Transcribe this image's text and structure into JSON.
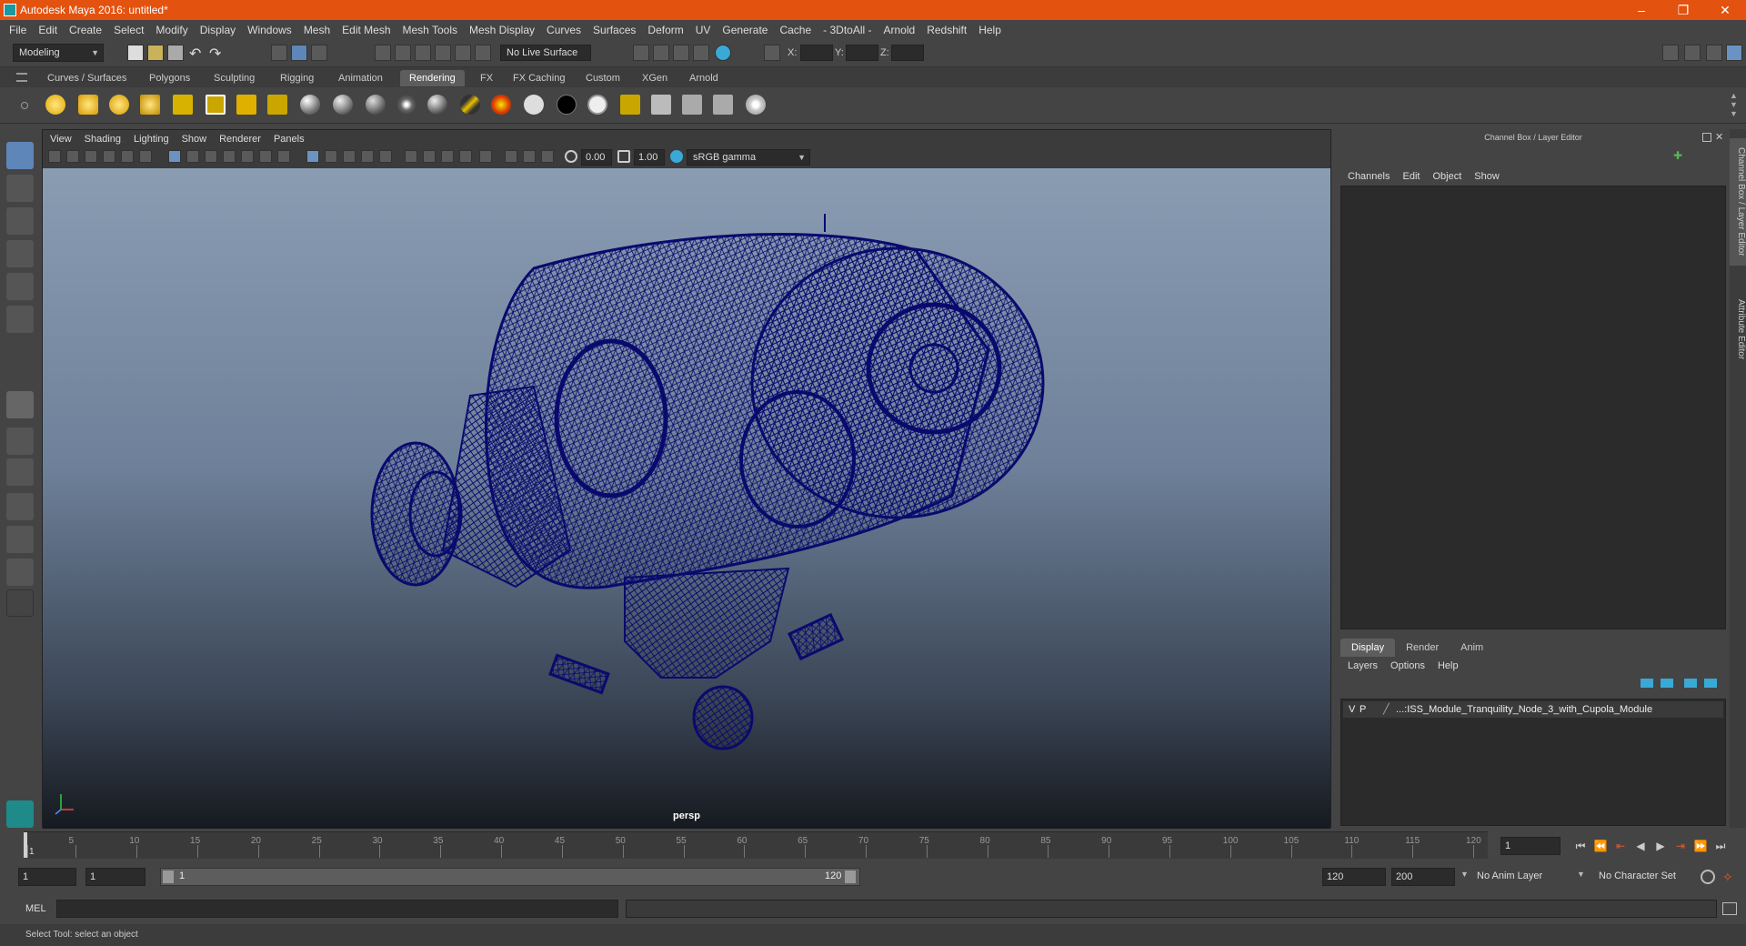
{
  "window": {
    "title": "Autodesk Maya 2016: untitled*"
  },
  "menubar": [
    "File",
    "Edit",
    "Create",
    "Select",
    "Modify",
    "Display",
    "Windows",
    "Mesh",
    "Edit Mesh",
    "Mesh Tools",
    "Mesh Display",
    "Curves",
    "Surfaces",
    "Deform",
    "UV",
    "Generate",
    "Cache",
    "- 3DtoAll -",
    "Arnold",
    "Redshift",
    "Help"
  ],
  "statusline": {
    "mode": "Modeling",
    "live_surface": "No Live Surface",
    "x_label": "X:",
    "y_label": "Y:",
    "z_label": "Z:"
  },
  "shelf_tabs": [
    "Curves / Surfaces",
    "Polygons",
    "Sculpting",
    "Rigging",
    "Animation",
    "Rendering",
    "FX",
    "FX Caching",
    "Custom",
    "XGen",
    "Arnold"
  ],
  "shelf_active_tab": "Rendering",
  "viewport": {
    "menu": [
      "View",
      "Shading",
      "Lighting",
      "Show",
      "Renderer",
      "Panels"
    ],
    "exposure": "0.00",
    "gamma": "1.00",
    "color_space": "sRGB gamma",
    "camera_label": "persp",
    "wireframe_color": "#0a0a6e"
  },
  "channel_box": {
    "header": "Channel Box / Layer Editor",
    "menu": [
      "Channels",
      "Edit",
      "Object",
      "Show"
    ]
  },
  "layer_editor": {
    "tabs": [
      "Display",
      "Render",
      "Anim"
    ],
    "active_tab": "Display",
    "menu": [
      "Layers",
      "Options",
      "Help"
    ],
    "layers": [
      {
        "v": "V",
        "p": "P",
        "name": "...:ISS_Module_Tranquility_Node_3_with_Cupola_Module"
      }
    ]
  },
  "side_tabs": [
    "Channel Box / Layer Editor",
    "Attribute Editor"
  ],
  "timeline": {
    "ticks": [
      "1",
      "5",
      "10",
      "15",
      "20",
      "25",
      "30",
      "35",
      "40",
      "45",
      "50",
      "55",
      "60",
      "65",
      "70",
      "75",
      "80",
      "85",
      "90",
      "95",
      "100",
      "105",
      "110",
      "115",
      "120"
    ],
    "current_frame": "1"
  },
  "range": {
    "start": "1",
    "playback_start": "1",
    "slider_start": "1",
    "slider_end": "120",
    "playback_end": "120",
    "end": "200",
    "anim_layer": "No Anim Layer",
    "character_set": "No Character Set"
  },
  "command_line": {
    "label": "MEL"
  },
  "help_line": "Select Tool: select an object"
}
